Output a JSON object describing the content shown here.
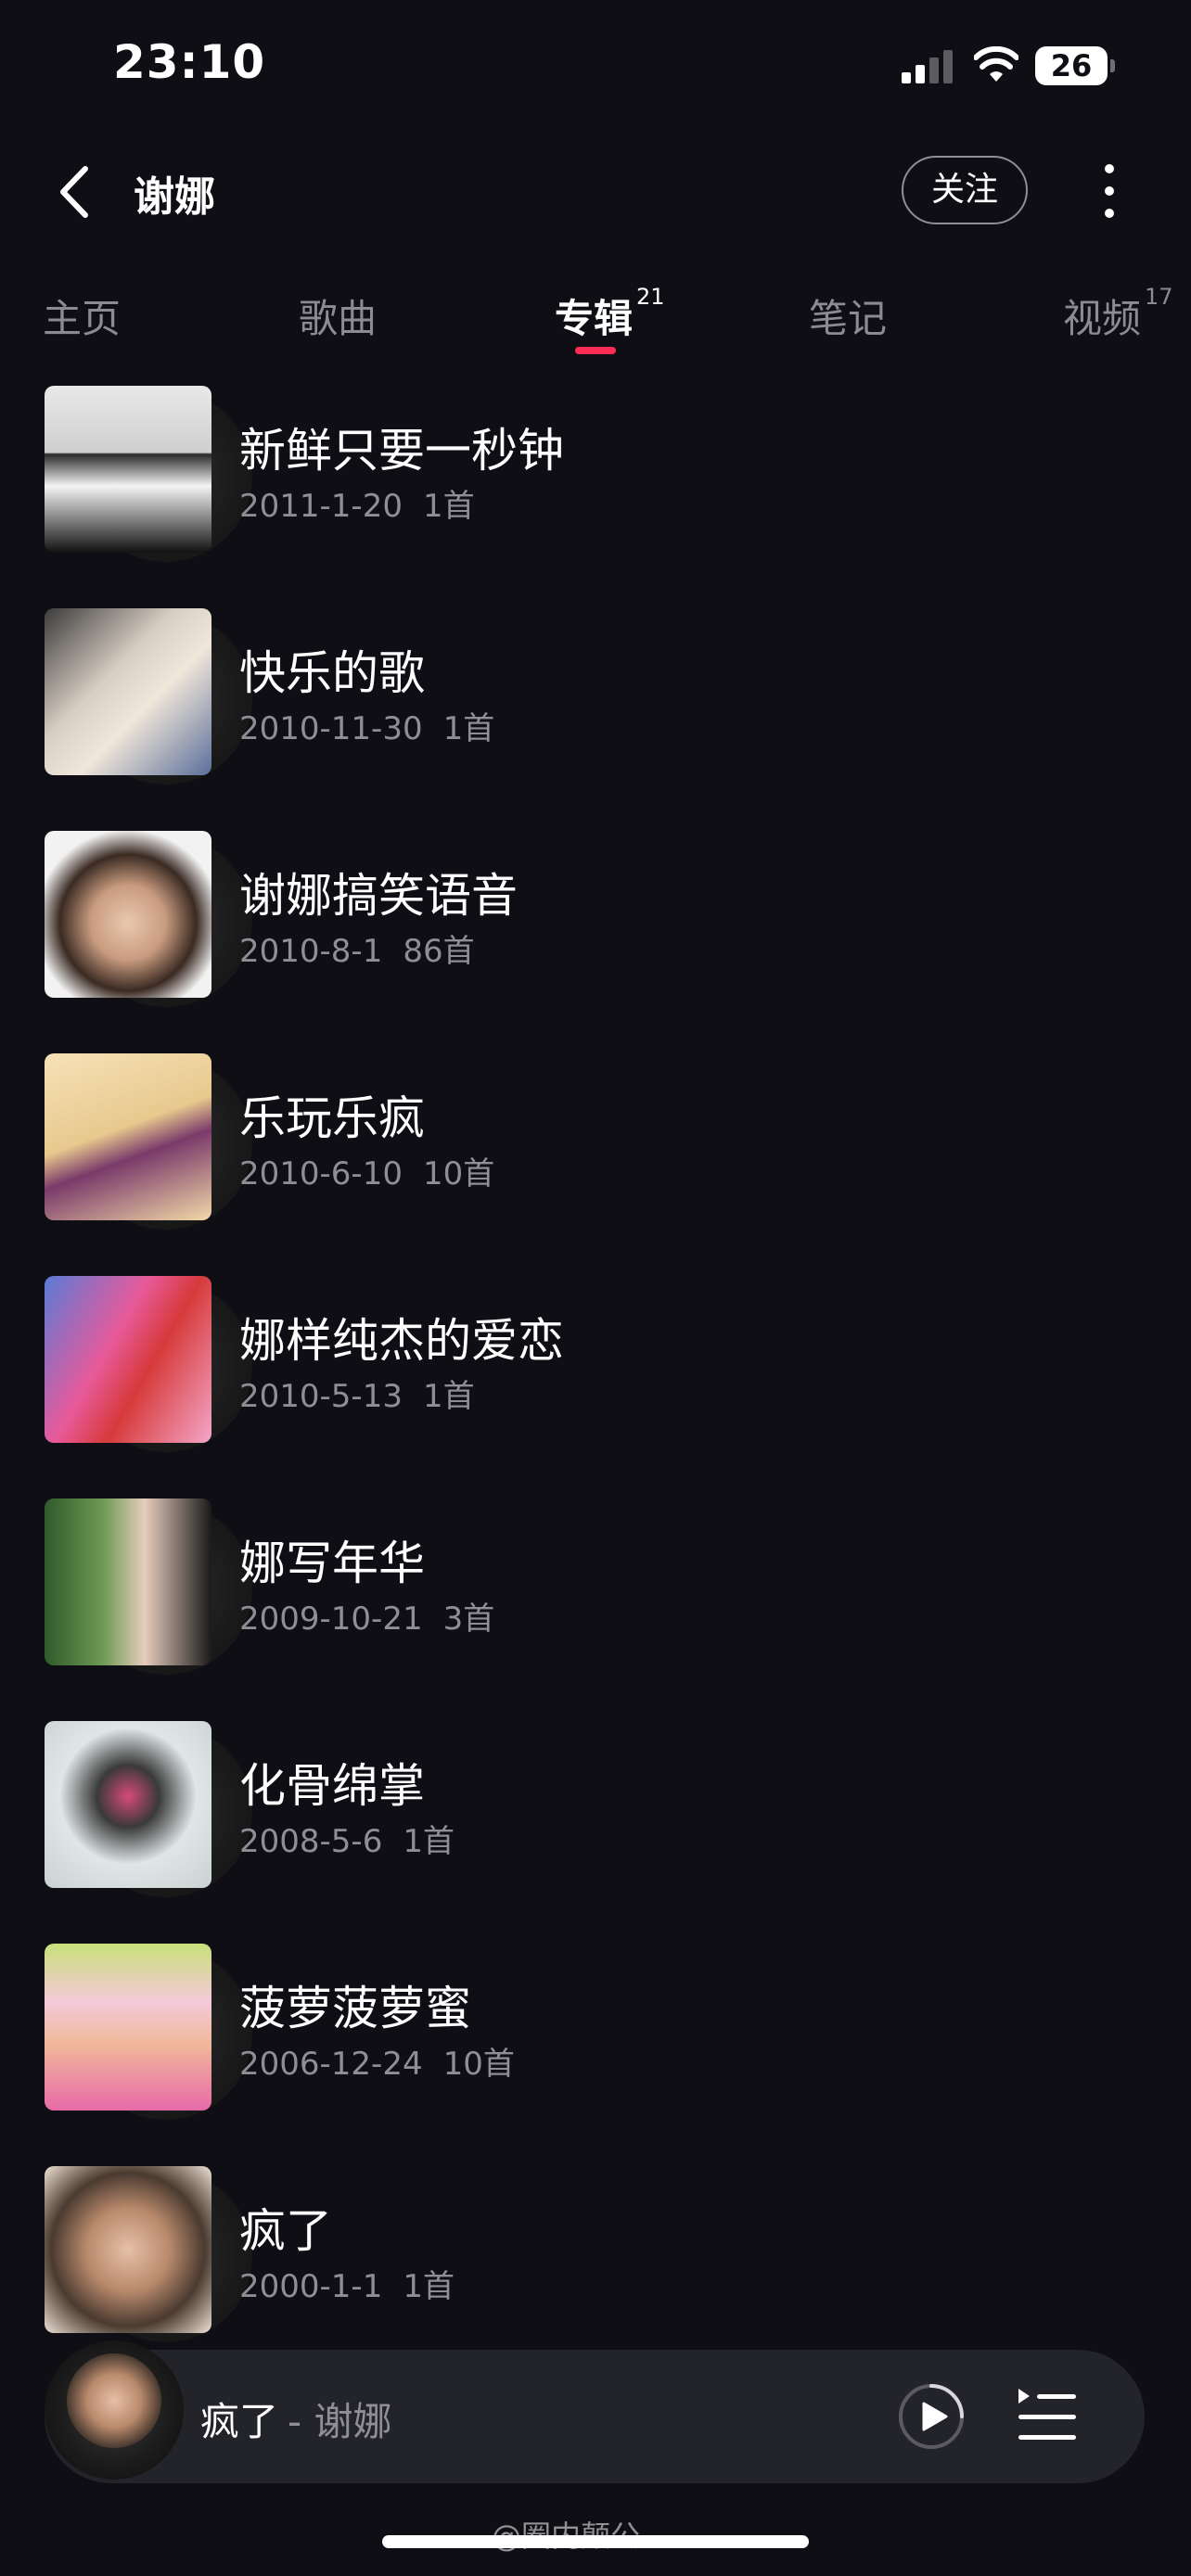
{
  "status_bar": {
    "time": "23:10",
    "battery": "26"
  },
  "header": {
    "title": "谢娜",
    "follow_label": "关注"
  },
  "tabs": [
    {
      "label": "主页",
      "badge": ""
    },
    {
      "label": "歌曲",
      "badge": ""
    },
    {
      "label": "专辑",
      "badge": "21"
    },
    {
      "label": "笔记",
      "badge": ""
    },
    {
      "label": "视频",
      "badge": "17"
    }
  ],
  "active_tab": "专辑",
  "albums": [
    {
      "title": "新鲜只要一秒钟",
      "date": "2011-1-20",
      "count": "1首"
    },
    {
      "title": "快乐的歌",
      "date": "2010-11-30",
      "count": "1首"
    },
    {
      "title": "谢娜搞笑语音",
      "date": "2010-8-1",
      "count": "86首"
    },
    {
      "title": "乐玩乐疯",
      "date": "2010-6-10",
      "count": "10首"
    },
    {
      "title": "娜样纯杰的爱恋",
      "date": "2010-5-13",
      "count": "1首"
    },
    {
      "title": "娜写年华",
      "date": "2009-10-21",
      "count": "3首"
    },
    {
      "title": "化骨绵掌",
      "date": "2008-5-6",
      "count": "1首"
    },
    {
      "title": "菠萝菠萝蜜",
      "date": "2006-12-24",
      "count": "10首"
    },
    {
      "title": "疯了",
      "date": "2000-1-1",
      "count": "1首"
    }
  ],
  "player": {
    "song": "疯了",
    "artist": "- 谢娜"
  },
  "watermark": "@圈内颠公",
  "colors": {
    "background": "#0e0e14",
    "accent": "#ff2d55",
    "text_secondary": "#8e8e94",
    "player_bg": "#23232a"
  },
  "icons": {
    "back": "chevron-left-icon",
    "more": "more-vertical-icon",
    "play": "play-circle-icon",
    "queue": "playlist-icon"
  }
}
